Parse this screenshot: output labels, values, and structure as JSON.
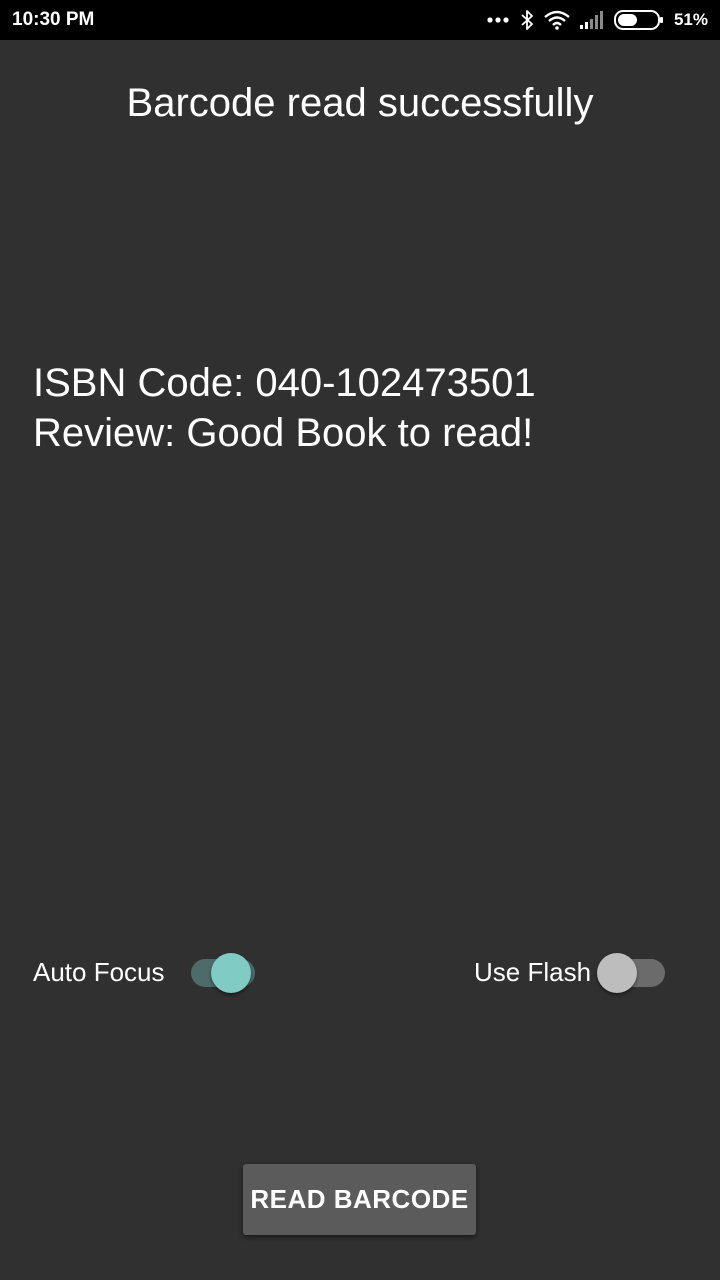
{
  "status_bar": {
    "time": "10:30 PM",
    "battery_percent": "51%",
    "icons": [
      "more-dots-icon",
      "bluetooth-icon",
      "wifi-icon",
      "signal-icon",
      "battery-icon"
    ],
    "battery_level": 0.51
  },
  "header": {
    "title": "Barcode read successfully"
  },
  "result": {
    "isbn_line": "ISBN Code: 040-102473501",
    "review_line": "Review: Good Book to read!"
  },
  "settings": {
    "auto_focus": {
      "label": "Auto Focus",
      "on": true
    },
    "use_flash": {
      "label": "Use Flash",
      "on": false
    }
  },
  "actions": {
    "read_barcode_label": "READ BARCODE"
  },
  "colors": {
    "background": "#303030",
    "status_bar": "#000000",
    "accent": "#80cbc4",
    "button": "#5b5b5b"
  }
}
